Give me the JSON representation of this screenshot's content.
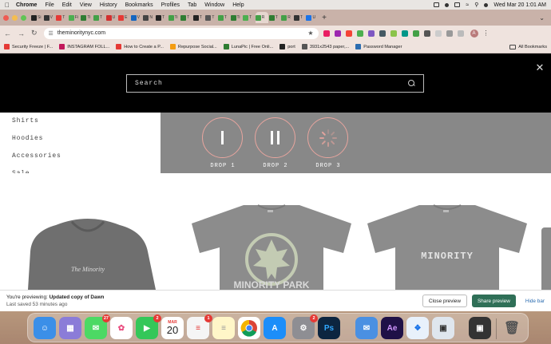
{
  "menubar": {
    "app": "Chrome",
    "items": [
      "File",
      "Edit",
      "View",
      "History",
      "Bookmarks",
      "Profiles",
      "Tab",
      "Window",
      "Help"
    ],
    "datetime": "Wed Mar 20  1:01 AM"
  },
  "tabs": [
    {
      "label": "Si"
    },
    {
      "label": "V"
    },
    {
      "label": "T"
    },
    {
      "label": "Fi"
    },
    {
      "label": "Ti"
    },
    {
      "label": "T"
    },
    {
      "label": "U"
    },
    {
      "label": "E"
    },
    {
      "label": "V"
    },
    {
      "label": "N"
    },
    {
      "label": "T"
    },
    {
      "label": "Ti"
    },
    {
      "label": "T"
    },
    {
      "label": "T"
    },
    {
      "label": "T"
    },
    {
      "label": "T"
    },
    {
      "label": "Ti"
    },
    {
      "label": "T"
    },
    {
      "label": "R"
    },
    {
      "label": "T"
    },
    {
      "label": "R"
    },
    {
      "label": "T"
    },
    {
      "label": "U"
    }
  ],
  "address": {
    "url": "theminoritynyc.com",
    "profile_initial": "A"
  },
  "bookmarks": [
    {
      "label": "Security Freeze | F...",
      "color": "#e53935"
    },
    {
      "label": "INSTAGRAM FOLL...",
      "color": "#c2185b"
    },
    {
      "label": "How to Create a P...",
      "color": "#e53935"
    },
    {
      "label": "Repurpose Social...",
      "color": "#f39c12"
    },
    {
      "label": "LunaPic | Free Onli...",
      "color": "#2e7d32"
    },
    {
      "label": "port",
      "color": "#222222"
    },
    {
      "label": "3931x2543 paper,...",
      "color": "#555555"
    },
    {
      "label": "Password Manager",
      "color": "#2b6cb0"
    }
  ],
  "bookmarks_all": "All Bookmarks",
  "site": {
    "search_placeholder": "Search",
    "nav": [
      "Shirts",
      "Hoodies",
      "Accessories",
      "Sale"
    ],
    "drops": [
      {
        "label": "DROP 1",
        "icon": "pause-single-icon"
      },
      {
        "label": "DROP 2",
        "icon": "pause-icon"
      },
      {
        "label": "DROP 3",
        "icon": "loading-spinner-icon"
      }
    ],
    "products": [
      {
        "print": "The Minority"
      },
      {
        "print": "MINORITY PARK"
      },
      {
        "print": "MINORITY"
      }
    ]
  },
  "preview": {
    "prefix": "You're previewing: ",
    "theme": "Updated copy of Dawn",
    "saved": "Last saved 53 minutes ago",
    "close_label": "Close preview",
    "share_label": "Share preview",
    "hide_label": "Hide bar"
  },
  "dock": {
    "messages_badge": "27",
    "facetime_badge": "2",
    "reminders_badge": "1",
    "settings_badge": "2",
    "calendar_month": "MAR",
    "calendar_day": "20",
    "ps_label": "Ps",
    "ae_label": "Ae"
  }
}
